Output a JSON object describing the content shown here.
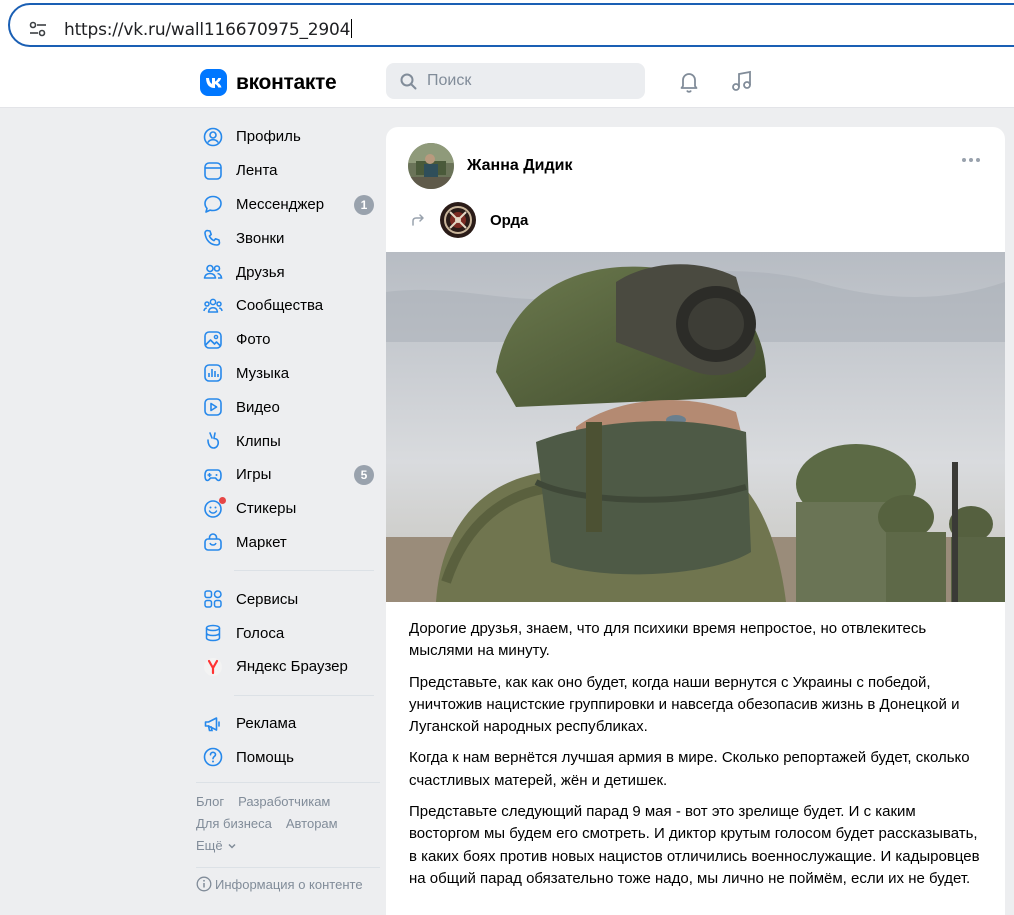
{
  "browser": {
    "url": "https://vk.ru/wall116670975_2904"
  },
  "header": {
    "logo_text": "вконтакте",
    "search_placeholder": "Поиск",
    "accent": "#0077ff"
  },
  "sidebar": {
    "items": [
      {
        "label": "Профиль",
        "icon": "profile-icon"
      },
      {
        "label": "Лента",
        "icon": "news-feed-icon"
      },
      {
        "label": "Мессенджер",
        "icon": "messenger-icon",
        "badge": "1"
      },
      {
        "label": "Звонки",
        "icon": "phone-icon"
      },
      {
        "label": "Друзья",
        "icon": "friends-icon"
      },
      {
        "label": "Сообщества",
        "icon": "communities-icon"
      },
      {
        "label": "Фото",
        "icon": "photo-icon"
      },
      {
        "label": "Музыка",
        "icon": "music-icon"
      },
      {
        "label": "Видео",
        "icon": "video-icon"
      },
      {
        "label": "Клипы",
        "icon": "clips-icon"
      },
      {
        "label": "Игры",
        "icon": "games-icon",
        "badge": "5"
      },
      {
        "label": "Стикеры",
        "icon": "stickers-icon"
      },
      {
        "label": "Маркет",
        "icon": "market-icon"
      }
    ],
    "items2": [
      {
        "label": "Сервисы",
        "icon": "services-icon"
      },
      {
        "label": "Голоса",
        "icon": "votes-icon"
      },
      {
        "label": "Яндекс Браузер",
        "icon": "yandex-browser-icon"
      }
    ],
    "items3": [
      {
        "label": "Реклама",
        "icon": "ads-icon"
      },
      {
        "label": "Помощь",
        "icon": "help-icon"
      }
    ],
    "footer": {
      "blog": "Блог",
      "developers": "Разработчикам",
      "business": "Для бизнеса",
      "authors": "Авторам",
      "more": "Ещё",
      "info": "Информация о контенте"
    }
  },
  "post": {
    "author": "Жанна Дидик",
    "source": "Орда",
    "paragraphs": [
      "Дорогие друзья, знаем, что для психики время непростое, но отвлекитесь мыслями на минуту.",
      "Представьте, как как оно будет, когда наши вернутся с Украины с победой, уничтожив нацистские группировки и навсегда обезопасив жизнь в Донецкой и Луганской народных республиках.",
      "Когда к нам вернётся лучшая армия в мире. Сколько репортажей будет, сколько счастливых матерей, жён и детишек.",
      "Представьте следующий парад 9 мая - вот это зрелище будет. И с каким восторгом мы будем его смотреть. И диктор крутым голосом будет рассказывать, в каких боях против новых нацистов отличились военнослужащие. И кадыровцев на общий парад обязательно тоже надо, мы лично не поймём, если их не будет."
    ]
  }
}
